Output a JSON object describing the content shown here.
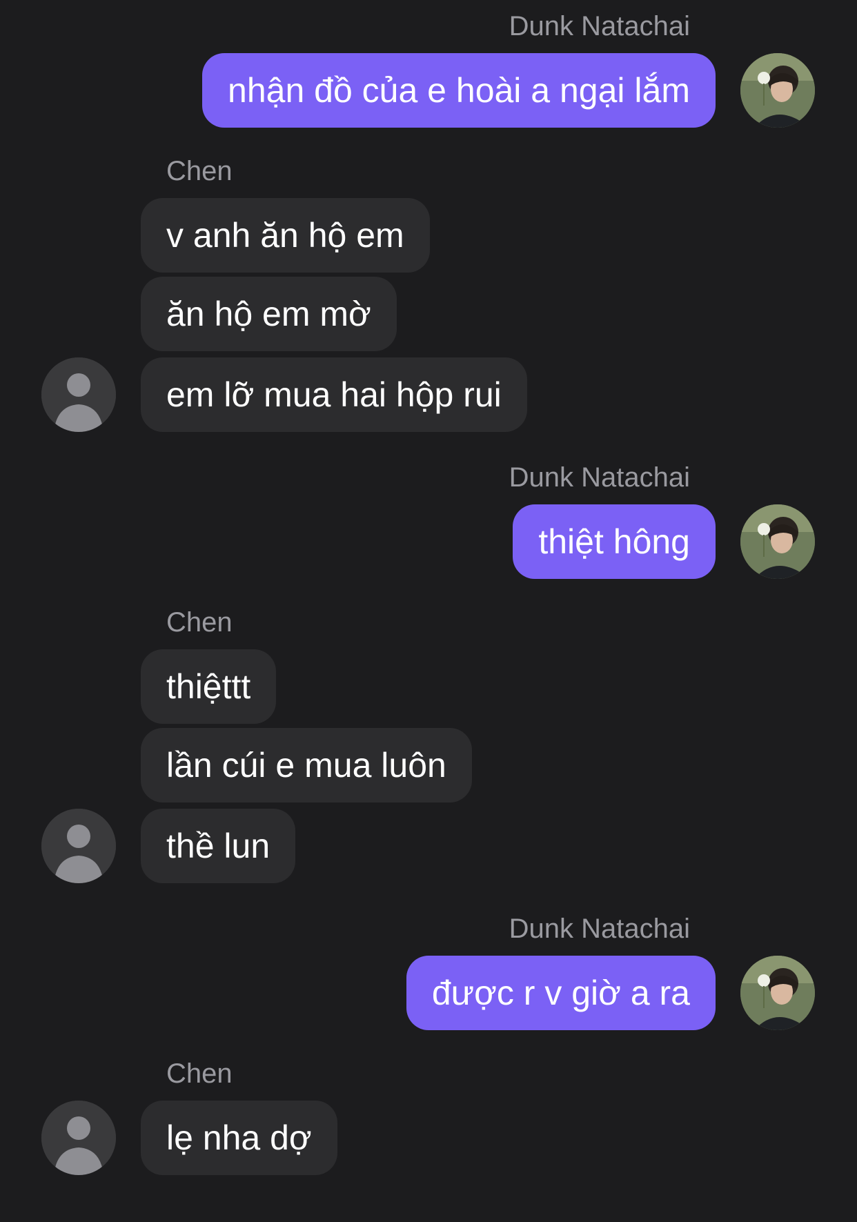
{
  "participants": {
    "me": "Dunk Natachai",
    "other": "Chen"
  },
  "groups": [
    {
      "sender": "Dunk Natachai",
      "side": "right",
      "messages": [
        "nhận đồ của e hoài a ngại lắm"
      ]
    },
    {
      "sender": "Chen",
      "side": "left",
      "messages": [
        "v anh ăn hộ em",
        "ăn hộ em mờ",
        "em lỡ mua hai hộp rui"
      ]
    },
    {
      "sender": "Dunk Natachai",
      "side": "right",
      "messages": [
        "thiệt hông"
      ]
    },
    {
      "sender": "Chen",
      "side": "left",
      "messages": [
        "thiệttt",
        "lần cúi e mua luôn",
        "thề lun"
      ]
    },
    {
      "sender": "Dunk Natachai",
      "side": "right",
      "messages": [
        "được r v giờ a ra"
      ]
    },
    {
      "sender": "Chen",
      "side": "left",
      "messages": [
        "lẹ nha dợ"
      ]
    }
  ],
  "colors": {
    "background": "#1c1c1e",
    "outgoing_bubble": "#7b61f5",
    "incoming_bubble": "#2c2c2e",
    "sender_name": "#9a9aa0"
  },
  "icons": {
    "me_avatar": "profile-photo",
    "other_avatar": "default-person-icon"
  }
}
